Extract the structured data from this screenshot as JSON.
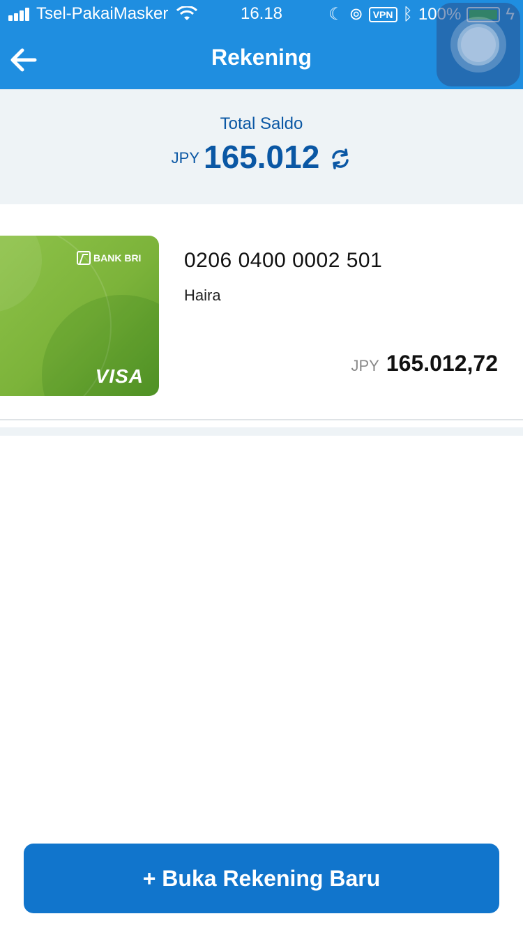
{
  "status_bar": {
    "carrier": "Tsel-PakaiMasker",
    "time": "16.18",
    "vpn": "VPN",
    "battery": "100%"
  },
  "header": {
    "title": "Rekening",
    "back_icon": "arrow-left-icon"
  },
  "balance": {
    "label": "Total Saldo",
    "currency": "JPY",
    "amount": "165.012",
    "refresh_icon": "refresh-icon"
  },
  "account": {
    "card_bank": "BANK BRI",
    "card_network": "VISA",
    "number": "0206 0400 0002 501",
    "holder": "Haira",
    "currency": "JPY",
    "amount": "165.012,72"
  },
  "actions": {
    "open_account_label": "+ Buka Rekening Baru"
  },
  "colors": {
    "primary": "#1f8ee0",
    "button": "#1175cc",
    "text_blue": "#0a57a4",
    "card_green": "#7cb33a",
    "background_gray": "#eef3f6"
  }
}
